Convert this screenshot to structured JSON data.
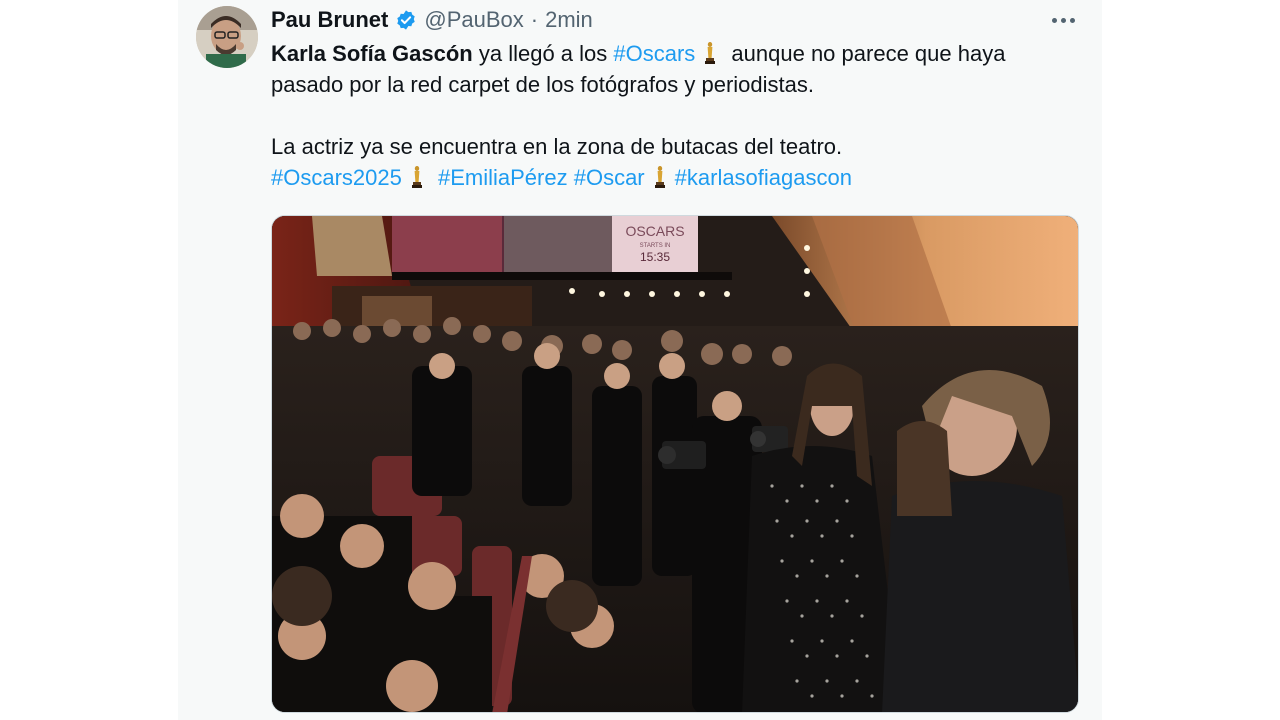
{
  "author": {
    "name": "Pau Brunet",
    "handle": "@PauBox",
    "separator": "·",
    "time": "2min",
    "verified_icon": "verified-badge-icon",
    "verified_color": "#1d9bf0"
  },
  "tweet": {
    "line1_bold": "Karla Sofía Gascón",
    "line1_a": " ya llegó a los ",
    "hashtag_oscars": "#Oscars",
    "line1_b": " aunque no parece que haya pasado por la red carpet de los fotógrafos y periodistas.",
    "line2": "La actriz ya se encuentra en la zona de butacas del teatro.",
    "hashtags": [
      "#Oscars2025",
      "#EmiliaPérez",
      "#Oscar",
      "#karlasofiagascon"
    ],
    "emoji_icon": "oscar-statuette-icon"
  },
  "media": {
    "screen_title": "OSCARS",
    "screen_subtitle": "STARTS IN",
    "screen_time": "15:35"
  },
  "colors": {
    "link": "#1d9bf0",
    "text": "#0f1419",
    "muted": "#536471",
    "card_bg": "#f7f9f9"
  }
}
